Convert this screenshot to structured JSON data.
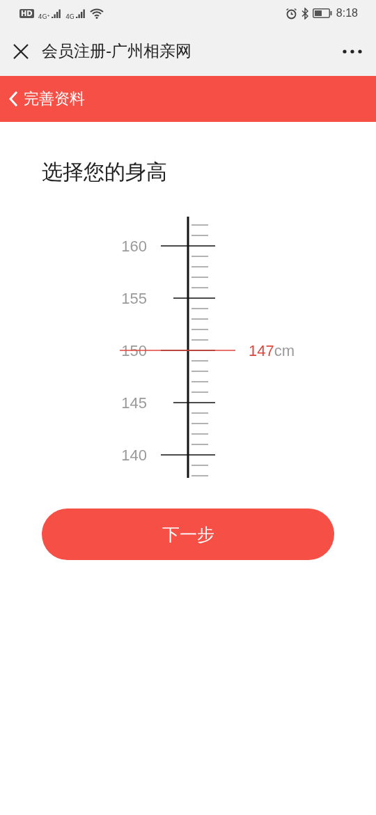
{
  "status_bar": {
    "badges": [
      "HD",
      "4G⁺",
      "4G"
    ],
    "time": "8:18"
  },
  "nav": {
    "title": "会员注册-广州相亲网"
  },
  "header": {
    "title": "完善资料"
  },
  "heading": "选择您的身高",
  "ruler": {
    "labels": [
      "160",
      "155",
      "150",
      "145",
      "140"
    ],
    "value": "147",
    "unit": "cm"
  },
  "next_button": "下一步"
}
